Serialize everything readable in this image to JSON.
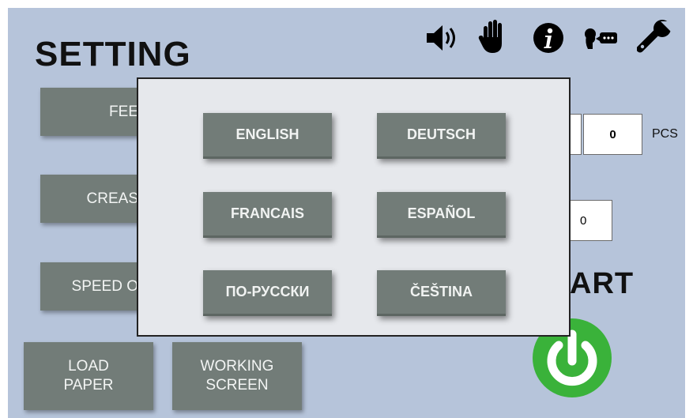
{
  "page": {
    "title": "SETTING"
  },
  "toolbar": {
    "icons": [
      "speaker-icon",
      "hand-stop-icon",
      "info-icon",
      "speech-icon",
      "wrench-icon"
    ]
  },
  "left_buttons": {
    "feed_label": "FEE",
    "crease_label": "CREAS",
    "speed_label": "SPEED O"
  },
  "bottom_buttons": {
    "load_paper_label": "LOAD\nPAPER",
    "working_screen_label": "WORKING\nSCREEN"
  },
  "counter": {
    "value": "0",
    "unit": "PCS",
    "second_value": "0"
  },
  "start": {
    "label": "ART"
  },
  "language_dialog": {
    "options": [
      "ENGLISH",
      "DEUTSCH",
      "FRANCAIS",
      "ESPAÑOL",
      "ПО-РУССКИ",
      "ČEŠTINA"
    ]
  },
  "colors": {
    "background": "#b6c4da",
    "button": "#727c78",
    "power_button": "#3ab23a",
    "dialog": "#e6e8ec"
  }
}
